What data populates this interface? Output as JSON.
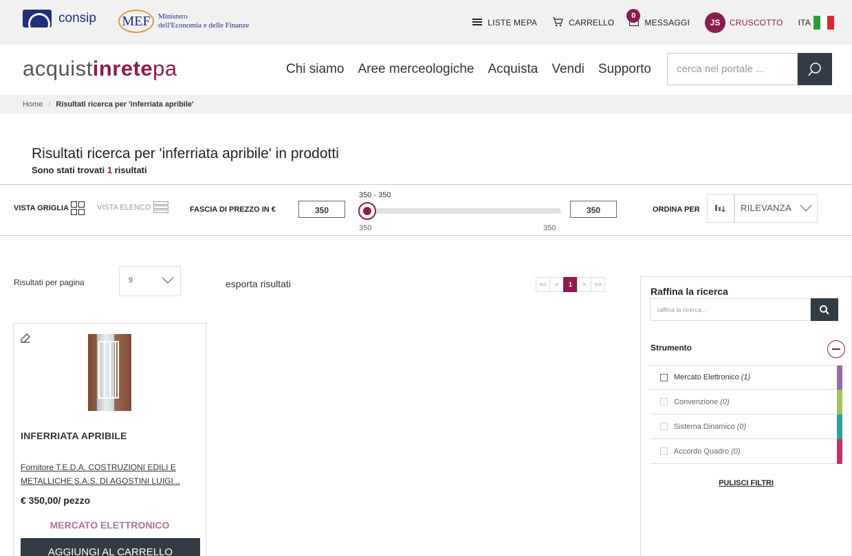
{
  "topbar": {
    "consip_label": "consip",
    "mef_abbr": "MEF",
    "mef_line1": "Ministero",
    "mef_line2": "dell'Economia e delle Finanze",
    "liste_mepa": "LISTE MEPA",
    "carrello": "CARRELLO",
    "messaggi": "MESSAGGI",
    "messages_count": "0",
    "avatar_initials": "JS",
    "cruscotto": "CRUSCOTTO",
    "language": "ITA"
  },
  "header": {
    "brand_part1": "acquist",
    "brand_part2": "inrete",
    "brand_part3": "pa",
    "nav": [
      "Chi siamo",
      "Aree merceologiche",
      "Acquista",
      "Vendi",
      "Supporto"
    ],
    "search_placeholder": "cerca nel portale ..."
  },
  "breadcrumb": {
    "home": "Home",
    "current": "Risultati ricerca per 'inferriata apribile'"
  },
  "results": {
    "title": "Risultati ricerca per 'inferriata apribile' in prodotti",
    "count_prefix": "Sono stati trovati",
    "count": "1",
    "count_suffix": "risultati"
  },
  "toolbar": {
    "vista_griglia": "VISTA GRIGLIA",
    "vista_elenco": "VISTA ELENCO",
    "fascia_prezzo": "FASCIA DI PREZZO IN €",
    "price_min": "350",
    "price_max": "350",
    "range_label": "350 - 350",
    "slider_min": "350",
    "slider_max": "350",
    "ordina_per": "ORDINA PER",
    "order_value": "RILEVANZA"
  },
  "listing": {
    "per_page_label": "Risultati per pagina",
    "per_page_value": "9",
    "export": "esporta risultati",
    "pagination": [
      "<<",
      "<",
      "1",
      ">",
      ">>"
    ],
    "current_page": "1"
  },
  "product": {
    "name": "INFERRIATA APRIBILE",
    "supplier": "Fornitore T.E.D.A. COSTRUZIONI EDILI E METALLICHE S.A.S. DI AGOSTINI LUIGI...",
    "price": "€ 350,00/ pezzo",
    "market": "MERCATO ELETTRONICO",
    "add_to_cart": "AGGIUNGI AL CARRELLO"
  },
  "refine": {
    "title": "Raffina la ricerca",
    "placeholder": "raffina la ricerca...",
    "strumento": "Strumento",
    "filters": [
      {
        "label": "Mercato Elettronico",
        "count": "(1)",
        "color": "#9b6aa8"
      },
      {
        "label": "Convenzione",
        "count": "(0)",
        "color": "#a5c25c"
      },
      {
        "label": "Sistema Dinamico",
        "count": "(0)",
        "color": "#27a39b"
      },
      {
        "label": "Accordo Quadro",
        "count": "(0)",
        "color": "#c2336a"
      }
    ],
    "clear": "PULISCI FILTRI"
  },
  "colors": {
    "accent": "#8a1d4e",
    "dark_button": "#333b44",
    "market_text": "#a8739a"
  }
}
